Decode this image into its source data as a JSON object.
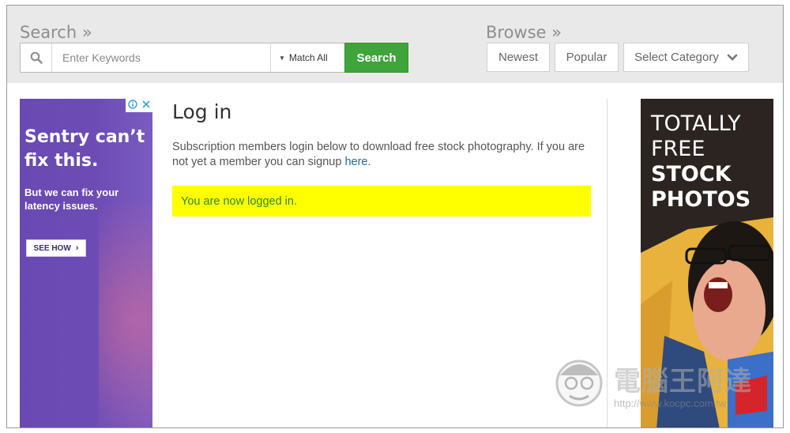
{
  "search": {
    "title": "Search »",
    "placeholder": "Enter Keywords",
    "match_label": "Match All",
    "button_label": "Search"
  },
  "browse": {
    "title": "Browse »",
    "newest": "Newest",
    "popular": "Popular",
    "category": "Select Category"
  },
  "ad_left": {
    "headline_1": "Sentry can’t",
    "headline_2": "fix this.",
    "sub": "But we can fix your latency issues.",
    "cta": "SEE HOW"
  },
  "main": {
    "title": "Log in",
    "intro": "Subscription members login below to download free stock photography. If you are not yet a member you can signup ",
    "intro_link": "here",
    "intro_end": ".",
    "notice": "You are now logged in."
  },
  "ad_right": {
    "line_1": "TOTALLY",
    "line_2": "FREE",
    "line_3": "STOCK",
    "line_4": "PHOTOS"
  },
  "watermark": {
    "text": "電腦王阿達",
    "url": "http://www.kocpc.com.tw"
  },
  "colors": {
    "search_button": "#3fa43a",
    "notice_bg": "#ffff00",
    "notice_text": "#2e8a2e",
    "ad_left_bg": "#6a49b3",
    "link": "#1e6aa5"
  },
  "icons": [
    "search-icon",
    "caret-down-icon",
    "chevron-down-icon",
    "adchoices-icon",
    "close-icon",
    "chevron-right-icon"
  ]
}
